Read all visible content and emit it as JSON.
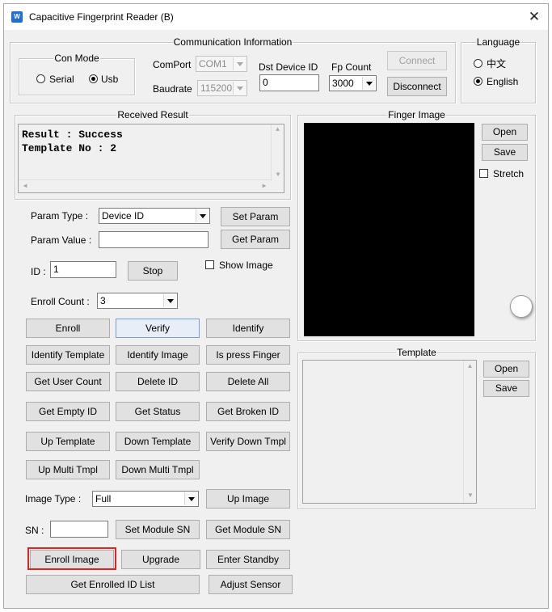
{
  "window": {
    "title": "Capacitive Fingerprint Reader (B)",
    "app_icon_text": "W",
    "close_glyph": "✕"
  },
  "communication": {
    "legend": "Communication Information",
    "con_mode": {
      "legend": "Con Mode",
      "serial": "Serial",
      "usb": "Usb",
      "selected": "Usb"
    },
    "comport_label": "ComPort",
    "comport_value": "COM1",
    "baudrate_label": "Baudrate",
    "baudrate_value": "115200",
    "dst_device_id_label": "Dst Device ID",
    "dst_device_id_value": "0",
    "fp_count_label": "Fp Count",
    "fp_count_value": "3000",
    "connect": "Connect",
    "disconnect": "Disconnect"
  },
  "language": {
    "legend": "Language",
    "chinese": "中文",
    "english": "English",
    "selected": "English"
  },
  "received": {
    "legend": "Received Result",
    "lines": [
      "Result : Success",
      "Template No : 2"
    ]
  },
  "params": {
    "param_type_label": "Param Type :",
    "param_type_value": "Device ID",
    "set_param": "Set Param",
    "param_value_label": "Param Value :",
    "param_value_value": "",
    "get_param": "Get Param",
    "id_label": "ID :",
    "id_value": "1",
    "stop": "Stop",
    "show_image": "Show Image",
    "enroll_count_label": "Enroll Count :",
    "enroll_count_value": "3"
  },
  "buttons": {
    "enroll": "Enroll",
    "verify": "Verify",
    "identify": "Identify",
    "identify_template": "Identify Template",
    "identify_image": "Identify Image",
    "is_press_finger": "Is press Finger",
    "get_user_count": "Get User Count",
    "delete_id": "Delete ID",
    "delete_all": "Delete All",
    "get_empty_id": "Get Empty ID",
    "get_status": "Get Status",
    "get_broken_id": "Get Broken ID",
    "up_template": "Up Template",
    "down_template": "Down Template",
    "verify_down_tmpl": "Verify Down Tmpl",
    "up_multi_tmpl": "Up Multi Tmpl",
    "down_multi_tmpl": "Down Multi Tmpl",
    "up_image": "Up Image",
    "set_module_sn": "Set Module SN",
    "get_module_sn": "Get Module SN",
    "enroll_image": "Enroll Image",
    "upgrade": "Upgrade",
    "enter_standby": "Enter Standby",
    "get_enrolled_id_list": "Get Enrolled ID List",
    "adjust_sensor": "Adjust Sensor"
  },
  "image_type": {
    "label": "Image Type :",
    "value": "Full"
  },
  "sn": {
    "label": "SN :",
    "value": ""
  },
  "finger_image": {
    "legend": "Finger Image",
    "open": "Open",
    "save": "Save",
    "stretch": "Stretch"
  },
  "template": {
    "legend": "Template",
    "open": "Open",
    "save": "Save"
  },
  "colors": {
    "highlight_border": "#e0231c",
    "image_bg": "#000000",
    "window_bg": "#f0f0f0"
  }
}
